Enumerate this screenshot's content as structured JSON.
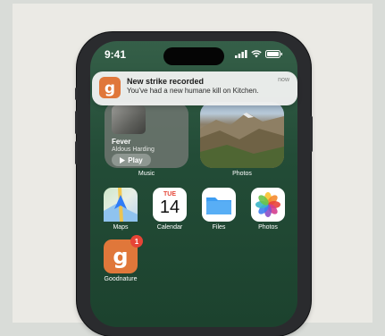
{
  "status_bar": {
    "time": "9:41"
  },
  "notification": {
    "title": "New strike recorded",
    "body": "You've had a new humane kill on Kitchen.",
    "time": "now",
    "app_icon": "goodnature-icon"
  },
  "widgets": {
    "music": {
      "song": "Fever",
      "artist": "Aldous Harding",
      "play_label": "Play",
      "label": "Music"
    },
    "photos": {
      "label": "Photos"
    }
  },
  "apps": [
    {
      "name": "Maps",
      "icon": "maps-icon"
    },
    {
      "name": "Calendar",
      "icon": "calendar-icon",
      "day": "TUE",
      "date": "14"
    },
    {
      "name": "Files",
      "icon": "files-icon"
    },
    {
      "name": "Photos",
      "icon": "photos-icon"
    },
    {
      "name": "Goodnature",
      "icon": "goodnature-icon",
      "badge": "1"
    }
  ],
  "colors": {
    "goodnature_orange": "#e0773a",
    "badge_red": "#e64436",
    "wallpaper_green": "#234c37"
  }
}
